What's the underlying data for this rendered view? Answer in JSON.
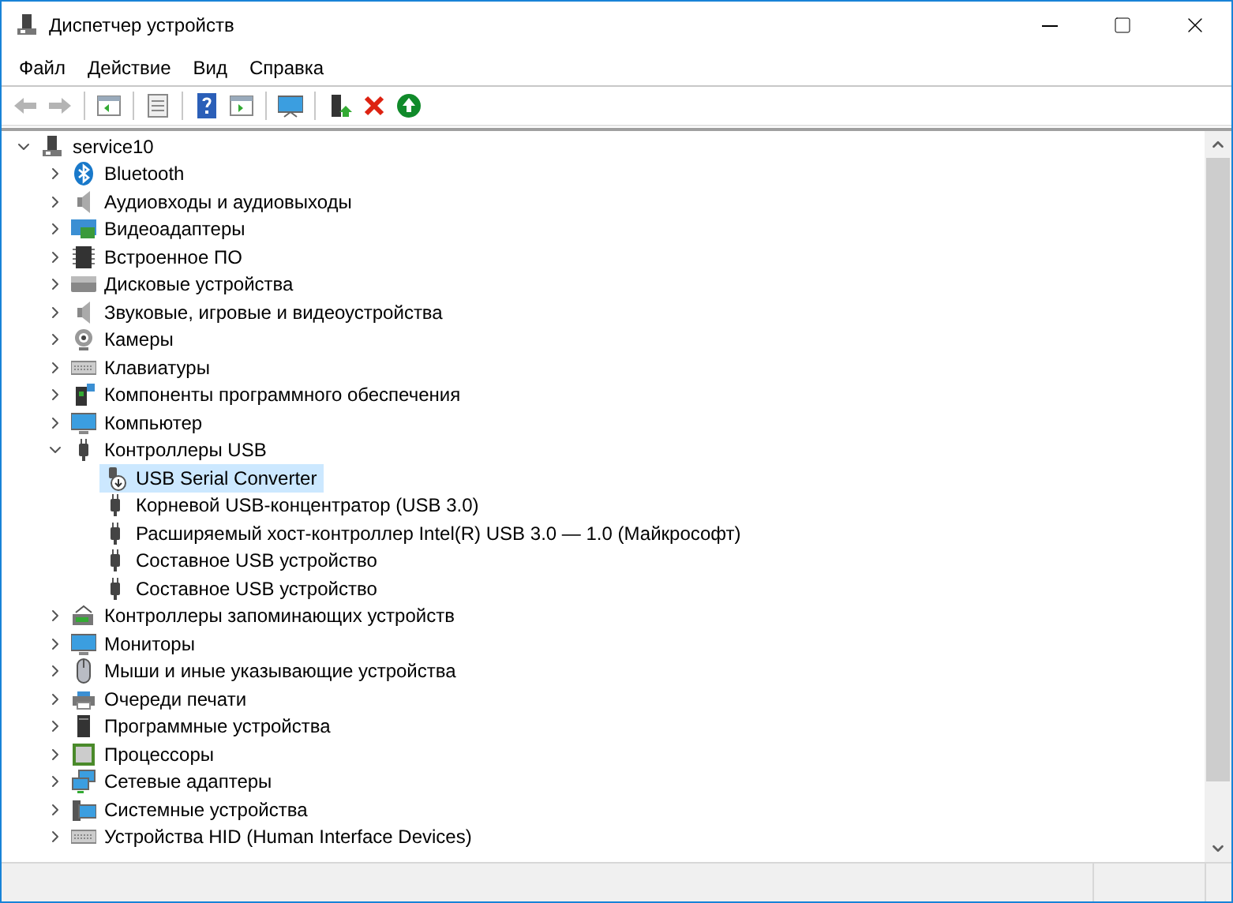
{
  "window": {
    "title": "Диспетчер устройств"
  },
  "menu": [
    {
      "label": "Файл"
    },
    {
      "label": "Действие"
    },
    {
      "label": "Вид"
    },
    {
      "label": "Справка"
    }
  ],
  "toolbar": {
    "groups": [
      {
        "buttons": [
          {
            "disabled": true
          },
          {
            "disabled": true
          }
        ]
      },
      {
        "buttons": [
          {
            "disabled": false
          }
        ]
      },
      {
        "buttons": [
          {
            "disabled": false
          }
        ]
      },
      {
        "buttons": [
          {
            "disabled": false
          },
          {
            "disabled": false
          }
        ]
      },
      {
        "buttons": [
          {
            "disabled": false
          }
        ]
      },
      {
        "buttons": [
          {
            "disabled": false
          },
          {
            "disabled": false
          },
          {
            "disabled": false
          }
        ]
      }
    ]
  },
  "tree": {
    "label": "service10",
    "expanded": true,
    "selected": false,
    "children": [
      {
        "label": "Bluetooth",
        "expanded": false,
        "selected": false
      },
      {
        "label": "Аудиовходы и аудиовыходы",
        "expanded": false,
        "selected": false
      },
      {
        "label": "Видеоадаптеры",
        "expanded": false,
        "selected": false
      },
      {
        "label": "Встроенное ПО",
        "expanded": false,
        "selected": false
      },
      {
        "label": "Дисковые устройства",
        "expanded": false,
        "selected": false
      },
      {
        "label": "Звуковые, игровые и видеоустройства",
        "expanded": false,
        "selected": false
      },
      {
        "label": "Камеры",
        "expanded": false,
        "selected": false
      },
      {
        "label": "Клавиатуры",
        "expanded": false,
        "selected": false
      },
      {
        "label": "Компоненты программного обеспечения",
        "expanded": false,
        "selected": false
      },
      {
        "label": "Компьютер",
        "expanded": false,
        "selected": false
      },
      {
        "label": "Контроллеры USB",
        "expanded": true,
        "selected": false,
        "children": [
          {
            "label": "USB Serial Converter",
            "selected": true
          },
          {
            "label": "Корневой USB-концентратор (USB 3.0)",
            "selected": false
          },
          {
            "label": "Расширяемый хост-контроллер Intel(R) USB 3.0 — 1.0 (Майкрософт)",
            "selected": false
          },
          {
            "label": "Составное USB устройство",
            "selected": false
          },
          {
            "label": "Составное USB устройство",
            "selected": false
          }
        ]
      },
      {
        "label": "Контроллеры запоминающих устройств",
        "expanded": false,
        "selected": false
      },
      {
        "label": "Мониторы",
        "expanded": false,
        "selected": false
      },
      {
        "label": "Мыши и иные указывающие устройства",
        "expanded": false,
        "selected": false
      },
      {
        "label": "Очереди печати",
        "expanded": false,
        "selected": false
      },
      {
        "label": "Программные устройства",
        "expanded": false,
        "selected": false
      },
      {
        "label": "Процессоры",
        "expanded": false,
        "selected": false
      },
      {
        "label": "Сетевые адаптеры",
        "expanded": false,
        "selected": false
      },
      {
        "label": "Системные устройства",
        "expanded": false,
        "selected": false
      },
      {
        "label": "Устройства HID (Human Interface Devices)",
        "expanded": false,
        "selected": false
      }
    ]
  }
}
